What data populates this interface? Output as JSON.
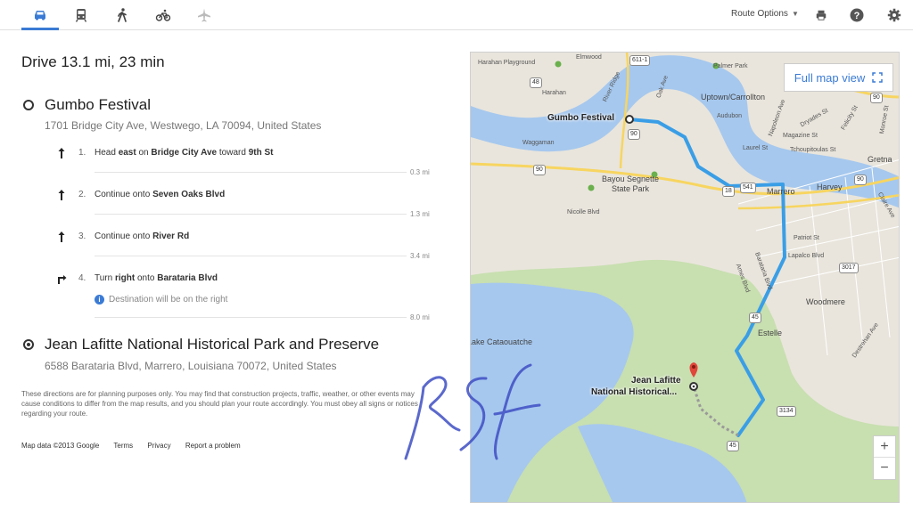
{
  "toolbar": {
    "modes": [
      {
        "name": "drive",
        "icon": "car-icon",
        "active": true
      },
      {
        "name": "transit",
        "icon": "train-icon",
        "active": false
      },
      {
        "name": "walk",
        "icon": "walking-icon",
        "active": false
      },
      {
        "name": "bike",
        "icon": "bicycle-icon",
        "active": false
      },
      {
        "name": "flight",
        "icon": "airplane-icon",
        "active": false
      }
    ],
    "route_options_label": "Route Options",
    "accent_color": "#3a7bd5"
  },
  "summary": "Drive 13.1 mi, 23 min",
  "origin": {
    "name": "Gumbo Festival",
    "address": "1701 Bridge City Ave, Westwego, LA 70094, United States"
  },
  "steps": [
    {
      "num": "1.",
      "pre": "Head ",
      "b1": "east",
      "mid": " on ",
      "b2": "Bridge City Ave",
      "mid2": " toward ",
      "b3": "9th St",
      "distance": "0.3 mi",
      "icon": "arrow-up-icon"
    },
    {
      "num": "2.",
      "pre": "Continue onto ",
      "b1": "Seven Oaks Blvd",
      "distance": "1.3 mi",
      "icon": "arrow-up-icon"
    },
    {
      "num": "3.",
      "pre": "Continue onto ",
      "b1": "River Rd",
      "distance": "3.4 mi",
      "icon": "arrow-up-icon"
    },
    {
      "num": "4.",
      "pre": "Turn ",
      "b1": "right",
      "mid": " onto ",
      "b2": "Barataria Blvd",
      "distance": "8.0 mi",
      "icon": "turn-right-icon"
    }
  ],
  "destination_note": "Destination will be on the right",
  "destination": {
    "name": "Jean Lafitte National Historical Park and Preserve",
    "address": "6588 Barataria Blvd, Marrero, Louisiana 70072, United States"
  },
  "disclaimer": "These directions are for planning purposes only. You may find that construction projects, traffic, weather, or other events may cause conditions to differ from the map results, and you should plan your route accordingly. You must obey all signs or notices regarding your route.",
  "footer": {
    "map_data": "Map data ©2013 Google",
    "terms": "Terms",
    "privacy": "Privacy",
    "report": "Report a problem"
  },
  "signature_text": "RSF",
  "map": {
    "full_map_label": "Full map view",
    "zoom_in": "+",
    "zoom_out": "−",
    "origin_label": "Gumbo Festival",
    "dest_label_1": "Jean Lafitte",
    "dest_label_2": "National Historical...",
    "places": {
      "harahan_playground": "Harahan Playground",
      "elmwood": "Elmwood",
      "palmer_park": "Palmer Park",
      "harahan": "Harahan",
      "river_ridge": "River Ridge",
      "oak_ave": "Oak Ave",
      "uptown": "Uptown/Carrollton",
      "audubon": "Audubon",
      "waggaman": "Waggaman",
      "bayou": "Bayou Segnette",
      "state_park": "State Park",
      "nicolle": "Nicolle Blvd",
      "marrero": "Marrero",
      "harvey": "Harvey",
      "gretna": "Gretna",
      "patriot": "Patriot St",
      "lapalco": "Lapalco Blvd",
      "woodmere": "Woodmere",
      "estelle": "Estelle",
      "lake": "Lake Cataouatche",
      "laurel": "Laurel St",
      "magazine": "Magazine St",
      "tchoup": "Tchoupitoulas St",
      "napoleon": "Napoleon Ave",
      "dryades": "Dryades St",
      "felicity": "Felicity St",
      "monroe": "Monroe St",
      "ames": "Ames Blvd",
      "barataria": "Barataria Blvd",
      "claire": "Claire Ave",
      "destrehan": "Destrehan Ave"
    },
    "shields": {
      "s611": "611-1",
      "s48": "48",
      "s90a": "90",
      "s90b": "90",
      "s90c": "90",
      "s541": "541",
      "s18": "18",
      "s3017": "3017",
      "s45a": "45",
      "s45b": "45",
      "s3134": "3134",
      "s90d": "90",
      "s90e": "90"
    },
    "colors": {
      "water": "#a6c8ee",
      "land": "#e9e5dc",
      "park": "#c8dfb0",
      "route": "#3a9ee6",
      "highway": "#f7d560"
    }
  }
}
